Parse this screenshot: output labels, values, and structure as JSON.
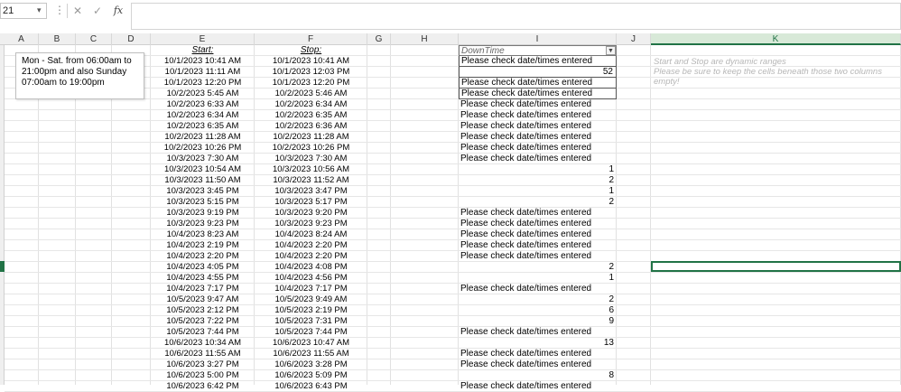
{
  "formula_bar": {
    "name_box": "21",
    "cancel_icon": "✕",
    "enter_icon": "✓",
    "fx_label": "fx",
    "formula": ""
  },
  "columns": [
    "A",
    "B",
    "C",
    "D",
    "E",
    "F",
    "G",
    "H",
    "I",
    "J",
    "K"
  ],
  "selected_column": "K",
  "headers": {
    "start": "Start:",
    "stop": "Stop:",
    "downtime": "DownTime"
  },
  "textbox": {
    "lines": [
      "Mon - Sat. from 06:00am to",
      "21:00pm and also Sunday",
      "07:00am to 19:00pm"
    ]
  },
  "notes": [
    "Start and Stop are dynamic ranges",
    "Please be sure to keep the cells beneath those two columns empty!"
  ],
  "rows": [
    {
      "start": "10/1/2023 10:41 AM",
      "stop": "10/1/2023 10:41 AM",
      "downtime": "Please check date/times entered"
    },
    {
      "start": "10/1/2023 11:11 AM",
      "stop": "10/1/2023 12:03 PM",
      "downtime": "52"
    },
    {
      "start": "10/1/2023 12:20 PM",
      "stop": "10/1/2023 12:20 PM",
      "downtime": "Please check date/times entered"
    },
    {
      "start": "10/2/2023 5:45 AM",
      "stop": "10/2/2023 5:46 AM",
      "downtime": "Please check date/times entered"
    },
    {
      "start": "10/2/2023 6:33 AM",
      "stop": "10/2/2023 6:34 AM",
      "downtime": "Please check date/times entered"
    },
    {
      "start": "10/2/2023 6:34 AM",
      "stop": "10/2/2023 6:35 AM",
      "downtime": "Please check date/times entered"
    },
    {
      "start": "10/2/2023 6:35 AM",
      "stop": "10/2/2023 6:36 AM",
      "downtime": "Please check date/times entered"
    },
    {
      "start": "10/2/2023 11:28 AM",
      "stop": "10/2/2023 11:28 AM",
      "downtime": "Please check date/times entered"
    },
    {
      "start": "10/2/2023 10:26 PM",
      "stop": "10/2/2023 10:26 PM",
      "downtime": "Please check date/times entered"
    },
    {
      "start": "10/3/2023 7:30 AM",
      "stop": "10/3/2023 7:30 AM",
      "downtime": "Please check date/times entered"
    },
    {
      "start": "10/3/2023 10:54 AM",
      "stop": "10/3/2023 10:56 AM",
      "downtime": "1"
    },
    {
      "start": "10/3/2023 11:50 AM",
      "stop": "10/3/2023 11:52 AM",
      "downtime": "2"
    },
    {
      "start": "10/3/2023 3:45 PM",
      "stop": "10/3/2023 3:47 PM",
      "downtime": "1"
    },
    {
      "start": "10/3/2023 5:15 PM",
      "stop": "10/3/2023 5:17 PM",
      "downtime": "2"
    },
    {
      "start": "10/3/2023 9:19 PM",
      "stop": "10/3/2023 9:20 PM",
      "downtime": "Please check date/times entered"
    },
    {
      "start": "10/3/2023 9:23 PM",
      "stop": "10/3/2023 9:23 PM",
      "downtime": "Please check date/times entered"
    },
    {
      "start": "10/4/2023 8:23 AM",
      "stop": "10/4/2023 8:24 AM",
      "downtime": "Please check date/times entered"
    },
    {
      "start": "10/4/2023 2:19 PM",
      "stop": "10/4/2023 2:20 PM",
      "downtime": "Please check date/times entered"
    },
    {
      "start": "10/4/2023 2:20 PM",
      "stop": "10/4/2023 2:20 PM",
      "downtime": "Please check date/times entered"
    },
    {
      "start": "10/4/2023 4:05 PM",
      "stop": "10/4/2023 4:08 PM",
      "downtime": "2"
    },
    {
      "start": "10/4/2023 4:55 PM",
      "stop": "10/4/2023 4:56 PM",
      "downtime": "1"
    },
    {
      "start": "10/4/2023 7:17 PM",
      "stop": "10/4/2023 7:17 PM",
      "downtime": "Please check date/times entered"
    },
    {
      "start": "10/5/2023 9:47 AM",
      "stop": "10/5/2023 9:49 AM",
      "downtime": "2"
    },
    {
      "start": "10/5/2023 2:12 PM",
      "stop": "10/5/2023 2:19 PM",
      "downtime": "6"
    },
    {
      "start": "10/5/2023 7:22 PM",
      "stop": "10/5/2023 7:31 PM",
      "downtime": "9"
    },
    {
      "start": "10/5/2023 7:44 PM",
      "stop": "10/5/2023 7:44 PM",
      "downtime": "Please check date/times entered"
    },
    {
      "start": "10/6/2023 10:34 AM",
      "stop": "10/6/2023 10:47 AM",
      "downtime": "13"
    },
    {
      "start": "10/6/2023 11:55 AM",
      "stop": "10/6/2023 11:55 AM",
      "downtime": "Please check date/times entered"
    },
    {
      "start": "10/6/2023 3:27 PM",
      "stop": "10/6/2023 3:28 PM",
      "downtime": "Please check date/times entered"
    },
    {
      "start": "10/6/2023 5:00 PM",
      "stop": "10/6/2023 5:09 PM",
      "downtime": "8"
    },
    {
      "start": "10/6/2023 6:42 PM",
      "stop": "10/6/2023 6:43 PM",
      "downtime": "Please check date/times entered"
    }
  ]
}
